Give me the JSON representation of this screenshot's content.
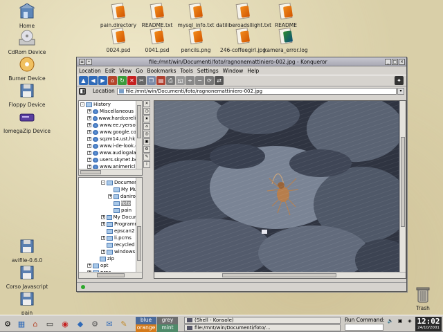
{
  "desktop_icons_left": [
    {
      "label": "Home",
      "icon": "home-icon"
    },
    {
      "label": "CdRom Device",
      "icon": "cdrom-icon"
    },
    {
      "label": "Burner Device",
      "icon": "burner-icon"
    },
    {
      "label": "Floppy Device",
      "icon": "floppy-icon"
    },
    {
      "label": "IomegaZip Device",
      "icon": "zip-drive-icon"
    },
    {
      "label": "avifile-0.6.0",
      "icon": "floppy-icon"
    },
    {
      "label": "Corso Javascript",
      "icon": "floppy-icon"
    },
    {
      "label": "pain",
      "icon": "floppy-icon"
    }
  ],
  "desktop_files_top": [
    {
      "label": "pain.directory",
      "icon": "text-file-icon"
    },
    {
      "label": "README.txt",
      "icon": "text-file-icon"
    },
    {
      "label": "mysql_info.txt",
      "icon": "text-file-icon"
    },
    {
      "label": "datiliberoadsllight.txt",
      "icon": "text-file-icon"
    },
    {
      "label": "README",
      "icon": "text-file-icon"
    }
  ],
  "desktop_files_row2": [
    {
      "label": "0024.psd",
      "icon": "text-file-icon"
    },
    {
      "label": "0041.psd",
      "icon": "text-file-icon"
    },
    {
      "label": "pencils.png",
      "icon": "text-file-icon"
    },
    {
      "label": "246-coffeegirl.jpg",
      "icon": "text-file-icon"
    },
    {
      "label": "kamera_error.log",
      "icon": "image-file-icon"
    }
  ],
  "trash": {
    "label": "Trash"
  },
  "window": {
    "title": "file:/mnt/win/Documenti/foto/ragnonemattiniero-002.jpg - Konqueror",
    "menu": [
      "Location",
      "Edit",
      "View",
      "Go",
      "Bookmarks",
      "Tools",
      "Settings",
      "Window",
      "Help"
    ],
    "location_label": "Location",
    "location_value": "file:/mnt/win/Documenti/foto/ragnonemattiniero-002.jpg"
  },
  "history_tree": [
    {
      "label": "History",
      "level": 0,
      "kind": "folder",
      "exp": "-"
    },
    {
      "label": "Miscellaneous",
      "level": 1,
      "kind": "globe",
      "exp": "+"
    },
    {
      "label": "www.hardcoreline",
      "level": 1,
      "kind": "globe",
      "exp": "+"
    },
    {
      "label": "www.ee.ryerson.",
      "level": 1,
      "kind": "globe",
      "exp": "+"
    },
    {
      "label": "www.google.com",
      "level": 1,
      "kind": "globe",
      "exp": "+"
    },
    {
      "label": "sqzm14.ust.hk",
      "level": 1,
      "kind": "globe",
      "exp": "+"
    },
    {
      "label": "www.i-de-look.or",
      "level": 1,
      "kind": "globe",
      "exp": "+"
    },
    {
      "label": "www.audiogalaxy",
      "level": 1,
      "kind": "globe",
      "exp": "+"
    },
    {
      "label": "users.skynet.be",
      "level": 1,
      "kind": "globe",
      "exp": "+"
    },
    {
      "label": "www.animericl",
      "level": 1,
      "kind": "globe",
      "exp": "+"
    }
  ],
  "folder_tree": [
    {
      "label": "Documenti",
      "level": 3,
      "exp": "-",
      "sel": false
    },
    {
      "label": "My Musi",
      "level": 4,
      "exp": "",
      "sel": false
    },
    {
      "label": "danirom.",
      "level": 4,
      "exp": "+",
      "sel": false
    },
    {
      "label": "foto",
      "level": 4,
      "exp": "",
      "sel": true
    },
    {
      "label": "pain",
      "level": 4,
      "exp": "",
      "sel": false
    },
    {
      "label": "My Docume",
      "level": 3,
      "exp": "+",
      "sel": false
    },
    {
      "label": "Programm",
      "level": 3,
      "exp": "+",
      "sel": false
    },
    {
      "label": "epscan2",
      "level": 3,
      "exp": "",
      "sel": false
    },
    {
      "label": "li.pcms",
      "level": 3,
      "exp": "+",
      "sel": false
    },
    {
      "label": "recycled",
      "level": 3,
      "exp": "",
      "sel": false
    },
    {
      "label": "windows",
      "level": 3,
      "exp": "+",
      "sel": false
    },
    {
      "label": "zip",
      "level": 2,
      "exp": "",
      "sel": false
    },
    {
      "label": "opt",
      "level": 1,
      "exp": "+",
      "sel": false
    },
    {
      "label": "proc",
      "level": 1,
      "exp": "+",
      "sel": false
    }
  ],
  "panel": {
    "desktops": [
      "blue",
      "grey",
      "orange",
      "mint"
    ],
    "desktop_colors": [
      "#4a6a9a",
      "#6e6e6e",
      "#d47a1a",
      "#4f8a6a"
    ],
    "tasks": [
      "(Shell - Konsole)",
      "file:/mnt/win/Documenti/foto/..."
    ],
    "run_label": "Run Command:",
    "clock_time": "12:02",
    "clock_date": "24/10/2001"
  }
}
